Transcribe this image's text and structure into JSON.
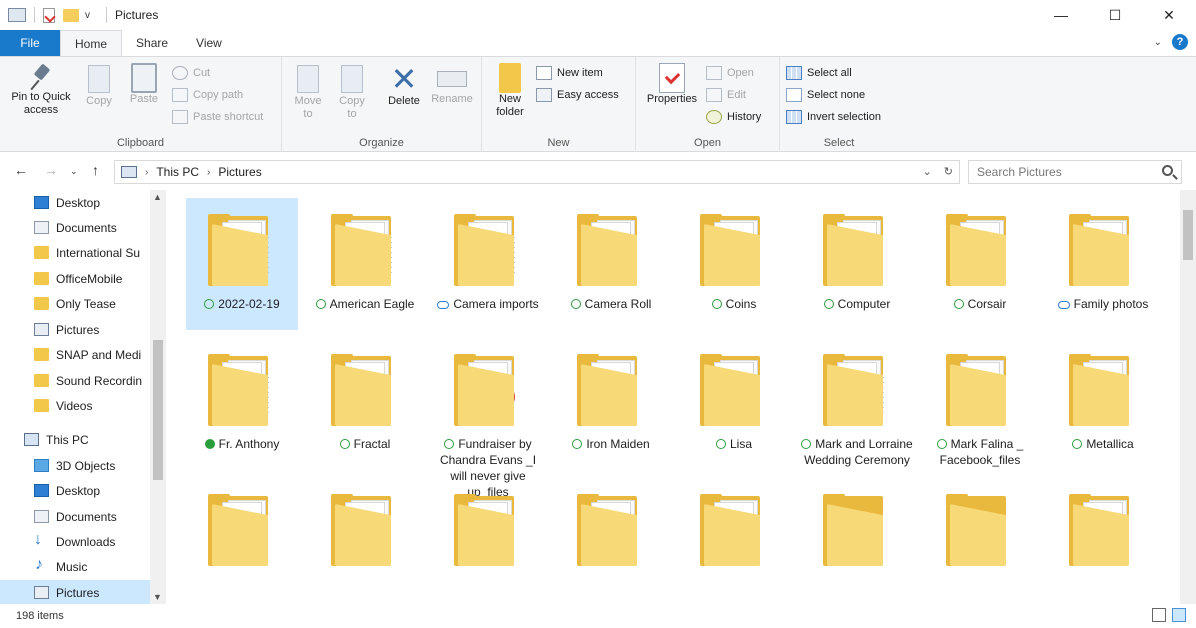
{
  "window": {
    "title": "Pictures",
    "qa_dropdown": "v",
    "min_glyph": "—",
    "max_glyph": "☐",
    "close_glyph": "✕"
  },
  "tabs": {
    "file": "File",
    "items": [
      "Home",
      "Share",
      "View"
    ],
    "help": "?"
  },
  "ribbon": {
    "clipboard": {
      "label": "Clipboard",
      "pin": "Pin to Quick access",
      "copy": "Copy",
      "paste": "Paste",
      "cut": "Cut",
      "copy_path": "Copy path",
      "paste_shortcut": "Paste shortcut"
    },
    "organize": {
      "label": "Organize",
      "move_to": "Move to",
      "copy_to": "Copy to",
      "delete": "Delete",
      "rename": "Rename"
    },
    "new": {
      "label": "New",
      "new_folder": "New folder",
      "new_item": "New item",
      "easy_access": "Easy access"
    },
    "open": {
      "label": "Open",
      "properties": "Properties",
      "open": "Open",
      "edit": "Edit",
      "history": "History"
    },
    "select": {
      "label": "Select",
      "select_all": "Select all",
      "select_none": "Select none",
      "invert": "Invert selection"
    }
  },
  "address": {
    "crumbs": [
      "This PC",
      "Pictures"
    ],
    "search_placeholder": "Search Pictures"
  },
  "nav": {
    "items": [
      {
        "label": "Desktop",
        "icon": "desktop-icon"
      },
      {
        "label": "Documents",
        "icon": "documents-icon"
      },
      {
        "label": "International Su",
        "icon": "folder-icon"
      },
      {
        "label": "OfficeMobile",
        "icon": "folder-icon"
      },
      {
        "label": "Only Tease",
        "icon": "folder-icon"
      },
      {
        "label": "Pictures",
        "icon": "pictures-icon"
      },
      {
        "label": "SNAP and Medi",
        "icon": "folder-icon"
      },
      {
        "label": "Sound Recordin",
        "icon": "folder-icon"
      },
      {
        "label": "Videos",
        "icon": "folder-icon"
      },
      {
        "label": "This PC",
        "icon": "this-pc-icon"
      },
      {
        "label": "3D Objects",
        "icon": "3d-objects-icon"
      },
      {
        "label": "Desktop",
        "icon": "desktop-icon"
      },
      {
        "label": "Documents",
        "icon": "documents-icon"
      },
      {
        "label": "Downloads",
        "icon": "downloads-icon"
      },
      {
        "label": "Music",
        "icon": "music-icon"
      },
      {
        "label": "Pictures",
        "icon": "pictures-icon"
      }
    ]
  },
  "files": [
    {
      "name": "2022-02-19",
      "status": "synced",
      "thumb": "document"
    },
    {
      "name": "American Eagle",
      "status": "synced",
      "thumb": "papers"
    },
    {
      "name": "Camera imports",
      "status": "cloud",
      "thumb": "papers"
    },
    {
      "name": "Camera Roll",
      "status": "synced",
      "thumb": "photo"
    },
    {
      "name": "Coins",
      "status": "synced",
      "thumb": "photo"
    },
    {
      "name": "Computer",
      "status": "synced",
      "thumb": "photo"
    },
    {
      "name": "Corsair",
      "status": "synced",
      "thumb": "photo"
    },
    {
      "name": "Family photos",
      "status": "cloud",
      "thumb": "photo"
    },
    {
      "name": "Fr. Anthony",
      "status": "pinned",
      "thumb": "document"
    },
    {
      "name": "Fractal",
      "status": "synced",
      "thumb": "photo"
    },
    {
      "name": "Fundraiser by Chandra Evans _I will never give up_files",
      "status": "synced",
      "thumb": "chrome"
    },
    {
      "name": "Iron Maiden",
      "status": "synced",
      "thumb": "photo"
    },
    {
      "name": "Lisa",
      "status": "synced",
      "thumb": "photo"
    },
    {
      "name": "Mark and Lorraine Wedding Ceremony",
      "status": "synced",
      "thumb": "papers"
    },
    {
      "name": "Mark Falina _ Facebook_files",
      "status": "synced",
      "thumb": "blank"
    },
    {
      "name": "Metallica",
      "status": "synced",
      "thumb": "photo"
    },
    {
      "name": "",
      "status": "",
      "thumb": "photo"
    },
    {
      "name": "",
      "status": "",
      "thumb": "photo"
    },
    {
      "name": "",
      "status": "",
      "thumb": "photo"
    },
    {
      "name": "",
      "status": "",
      "thumb": "photo"
    },
    {
      "name": "",
      "status": "",
      "thumb": "photo"
    },
    {
      "name": "",
      "status": "",
      "thumb": "empty"
    },
    {
      "name": "",
      "status": "",
      "thumb": "empty"
    },
    {
      "name": "",
      "status": "",
      "thumb": "photo"
    }
  ],
  "statusbar": {
    "count": "198 items"
  },
  "colors": {
    "accent": "#1979ca",
    "selection": "#cce8ff",
    "folder": "#f2c84b",
    "sync_green": "#2a9d3c"
  }
}
